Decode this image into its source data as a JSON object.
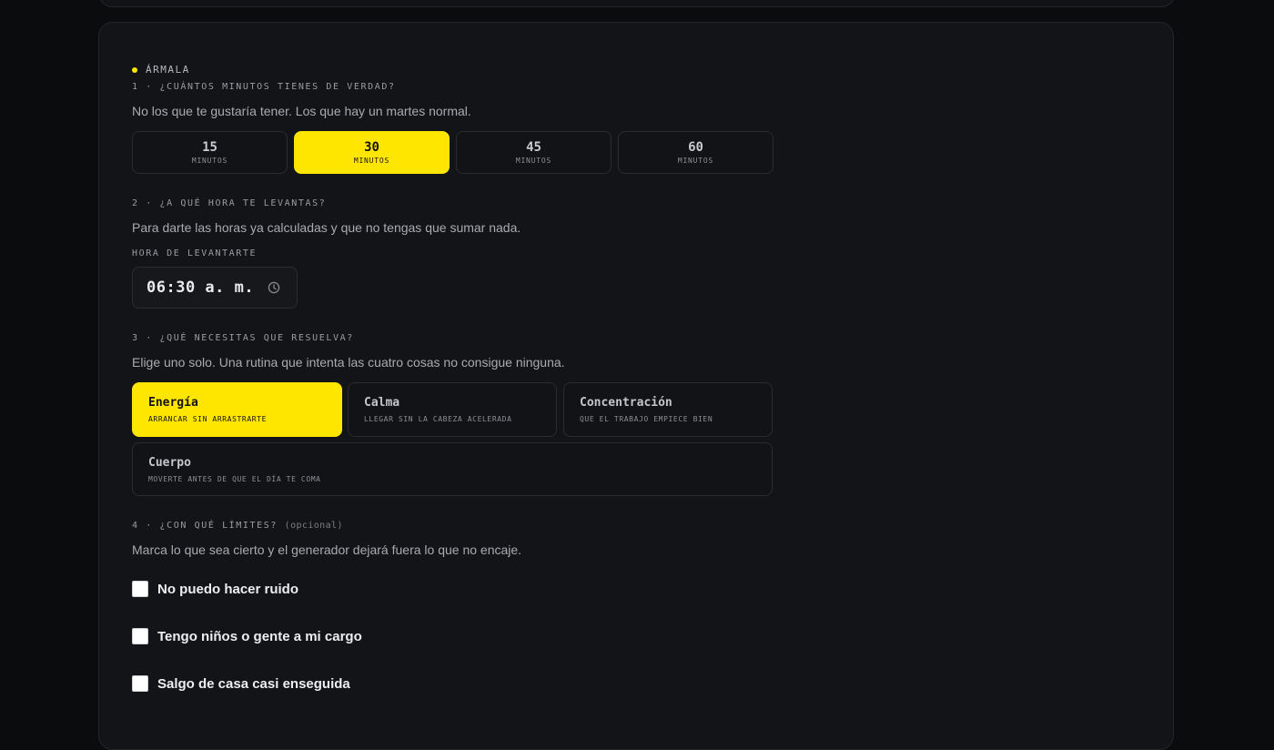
{
  "section": {
    "eyebrow": "ÁRMALA"
  },
  "q1": {
    "title": "1 · ¿CUÁNTOS MINUTOS TIENES DE VERDAD?",
    "desc": "No los que te gustaría tener. Los que hay un martes normal.",
    "unit": "MINUTOS",
    "options": [
      "15",
      "30",
      "45",
      "60"
    ],
    "selected": "30"
  },
  "q2": {
    "title": "2 · ¿A QUÉ HORA TE LEVANTAS?",
    "desc": "Para darte las horas ya calculadas y que no tengas que sumar nada.",
    "field_label": "HORA DE LEVANTARTE",
    "value": "06:30 a. m."
  },
  "q3": {
    "title": "3 · ¿QUÉ NECESITAS QUE RESUELVA?",
    "desc": "Elige uno solo. Una rutina que intenta las cuatro cosas no consigue ninguna.",
    "selected": "Energía",
    "options": [
      {
        "title": "Energía",
        "sub": "ARRANCAR SIN ARRASTRARTE"
      },
      {
        "title": "Calma",
        "sub": "LLEGAR SIN LA CABEZA ACELERADA"
      },
      {
        "title": "Concentración",
        "sub": "QUE EL TRABAJO EMPIECE BIEN"
      },
      {
        "title": "Cuerpo",
        "sub": "MOVERTE ANTES DE QUE EL DÍA TE COMA"
      }
    ]
  },
  "q4": {
    "title": "4 · ¿CON QUÉ LÍMITES?",
    "optional": "(opcional)",
    "desc": "Marca lo que sea cierto y el generador dejará fuera lo que no encaje.",
    "options": [
      {
        "label": "No puedo hacer ruido",
        "checked": false
      },
      {
        "label": "Tengo niños o gente a mi cargo",
        "checked": false
      },
      {
        "label": "Salgo de casa casi enseguida",
        "checked": false
      }
    ]
  },
  "colors": {
    "accent": "#ffe600",
    "background": "#0b0c0e",
    "panel": "#131417"
  },
  "icons": {
    "time_input": "clock-icon",
    "eyebrow": "dot-icon"
  }
}
